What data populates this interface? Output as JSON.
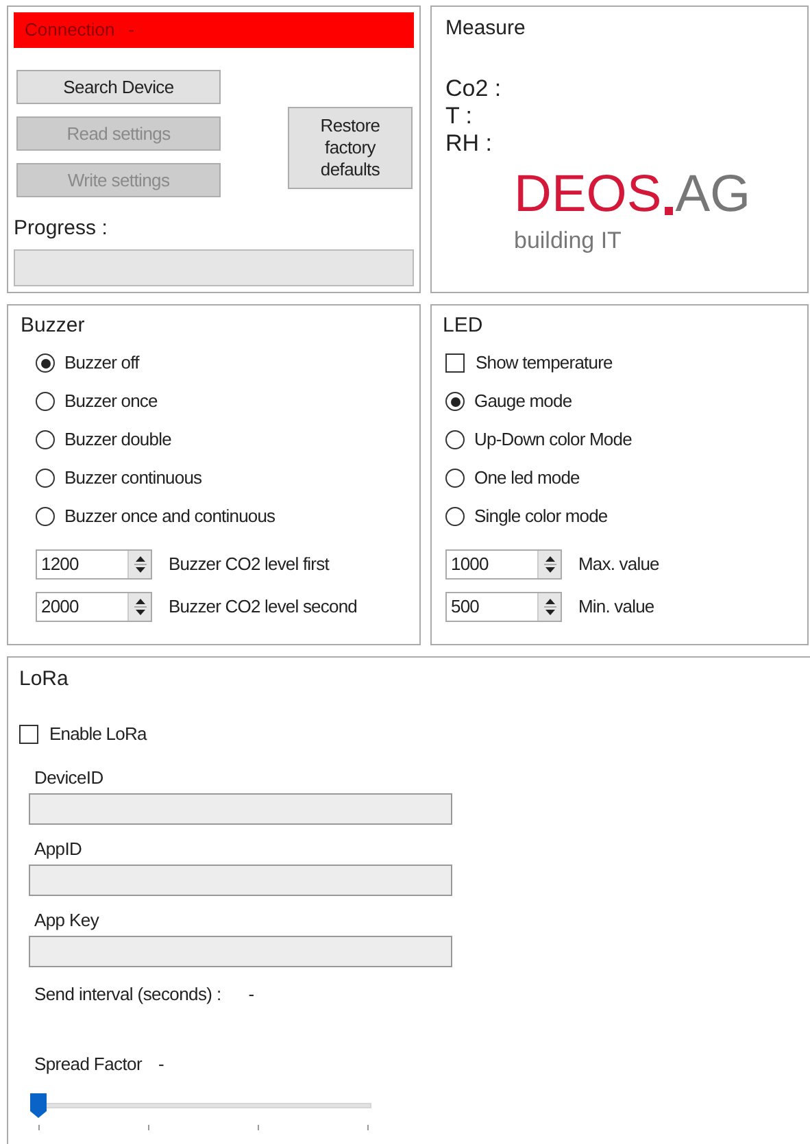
{
  "connection": {
    "title": "Connection",
    "status": "-",
    "connected": false,
    "buttons": [
      {
        "label": "Search Device",
        "disabled": false
      },
      {
        "label": "Read settings",
        "disabled": true
      },
      {
        "label": "Write settings",
        "disabled": true
      }
    ],
    "restore_button": {
      "label": "Restore factory defaults",
      "disabled": false
    },
    "progress": {
      "label": "Progress :",
      "level": 0
    }
  },
  "measure": {
    "title": "Measure",
    "readings": [
      "Co2 :",
      "T :",
      "RH :"
    ],
    "logo": {
      "name": "DEOS",
      "suffix": "AG",
      "tagline": "building IT"
    }
  },
  "buzzer": {
    "title": "Buzzer",
    "options": [
      {
        "label": "Buzzer off",
        "selected": true
      },
      {
        "label": "Buzzer once",
        "selected": false
      },
      {
        "label": "Buzzer double",
        "selected": false
      },
      {
        "label": "Buzzer continuous",
        "selected": false
      },
      {
        "label": "Buzzer once and continuous",
        "selected": false
      }
    ],
    "spinners": [
      {
        "value": "1200",
        "label": "Buzzer CO2 level first"
      },
      {
        "value": "2000",
        "label": "Buzzer CO2 level second"
      }
    ]
  },
  "led": {
    "title": "LED",
    "show_temperature": {
      "label": "Show temperature",
      "checked": false
    },
    "options": [
      {
        "label": "Gauge mode",
        "selected": true
      },
      {
        "label": "Up-Down color Mode",
        "selected": false
      },
      {
        "label": "One led mode",
        "selected": false
      },
      {
        "label": "Single color mode",
        "selected": false
      }
    ],
    "spinners": [
      {
        "value": "1000",
        "label": "Max. value"
      },
      {
        "value": "500",
        "label": "Min. value"
      }
    ]
  },
  "lora": {
    "title": "LoRa",
    "enable": {
      "label": "Enable LoRa",
      "checked": false
    },
    "fields": [
      {
        "label": "DeviceID",
        "disabled": true
      },
      {
        "label": "AppID",
        "disabled": true
      },
      {
        "label": "App Key",
        "disabled": true
      }
    ],
    "send_interval": {
      "label": "Send interval (seconds) :",
      "value": "-"
    },
    "spread_factor": {
      "label": "Spread Factor",
      "value": "-",
      "level": 0
    }
  }
}
